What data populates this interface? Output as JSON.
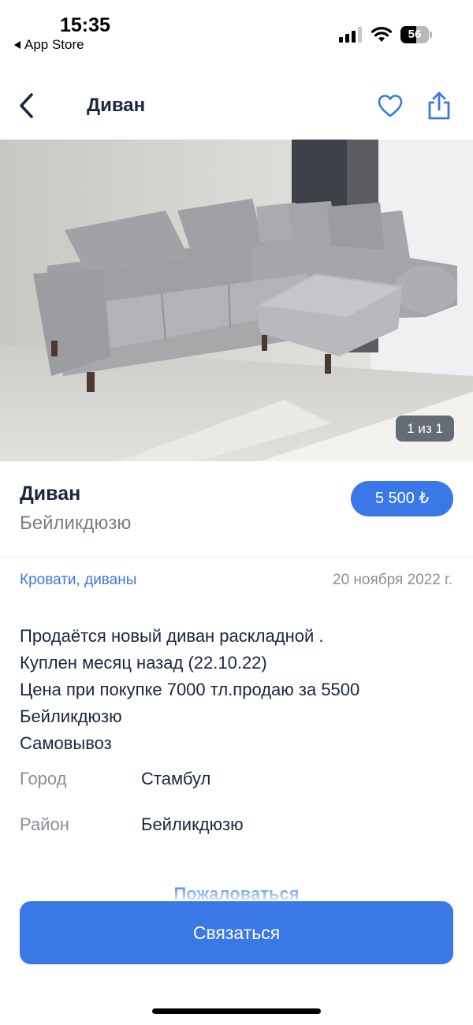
{
  "status_bar": {
    "time": "15:35",
    "back_app": "App Store",
    "battery_level": "56",
    "battery_fraction": 0.56,
    "signal_bars_active": 3,
    "signal_bars_total": 4
  },
  "nav": {
    "title": "Диван"
  },
  "photo": {
    "counter": "1 из 1"
  },
  "listing": {
    "title": "Диван",
    "location": "Бейликдюзю",
    "price": "5 500 ₺",
    "category": "Кровати, диваны",
    "date": "20 ноября 2022 г.",
    "description_lines": [
      "Продаётся новый диван раскладной .",
      "Куплен месяц назад (22.10.22)",
      "Цена при покупке 7000 тл.продаю за 5500",
      "Бейликдюзю",
      "Самовывоз"
    ],
    "properties": [
      {
        "label": "Город",
        "value": "Стамбул"
      },
      {
        "label": "Район",
        "value": "Бейликдюзю"
      }
    ]
  },
  "actions": {
    "report": "Пожаловаться",
    "contact": "Связаться"
  },
  "colors": {
    "accent": "#3b78e7",
    "text": "#1a2540",
    "muted": "#8a8e95"
  }
}
